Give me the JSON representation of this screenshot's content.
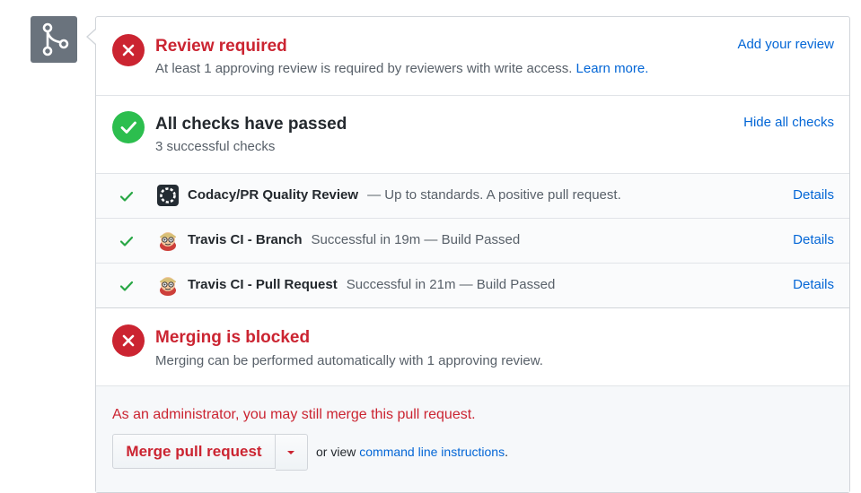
{
  "review": {
    "title": "Review required",
    "description": "At least 1 approving review is required by reviewers with write access.",
    "learn_more": "Learn more.",
    "action": "Add your review"
  },
  "checks": {
    "title": "All checks have passed",
    "description": "3 successful checks",
    "action": "Hide all checks",
    "items": [
      {
        "name": "Codacy/PR Quality Review",
        "status": "— Up to standards. A positive pull request.",
        "details": "Details",
        "icon": "codacy-logo-icon"
      },
      {
        "name": "Travis CI - Branch",
        "status": "Successful in 19m — Build Passed",
        "details": "Details",
        "icon": "travis-ci-mascot-icon"
      },
      {
        "name": "Travis CI - Pull Request",
        "status": "Successful in 21m — Build Passed",
        "details": "Details",
        "icon": "travis-ci-mascot-icon"
      }
    ]
  },
  "merge": {
    "title": "Merging is blocked",
    "description": "Merging can be performed automatically with 1 approving review.",
    "admin_note": "As an administrator, you may still merge this pull request.",
    "button_label": "Merge pull request",
    "or_view": "or view",
    "cli_link": "command line instructions",
    "period": "."
  },
  "icons": {
    "merge": "git-merge-icon",
    "failure": "x-icon",
    "success": "check-icon",
    "dropdown": "caret-down-icon"
  },
  "colors": {
    "danger": "#cb2431",
    "success": "#2cbe4e",
    "link": "#0366d6",
    "merge_icon_bg": "#6a737d"
  }
}
